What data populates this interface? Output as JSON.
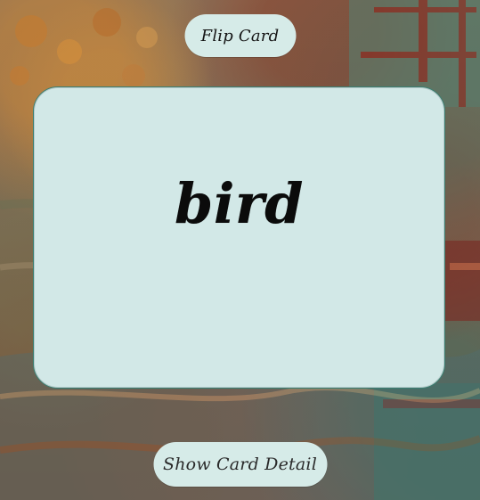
{
  "controls": {
    "flip_label": "Flip Card",
    "detail_label": "Show Card Detail"
  },
  "card": {
    "word": "bird"
  },
  "colors": {
    "card_bg": "#d2e8e7",
    "button_bg": "#d6ebe8",
    "card_border": "#3a7f72"
  }
}
